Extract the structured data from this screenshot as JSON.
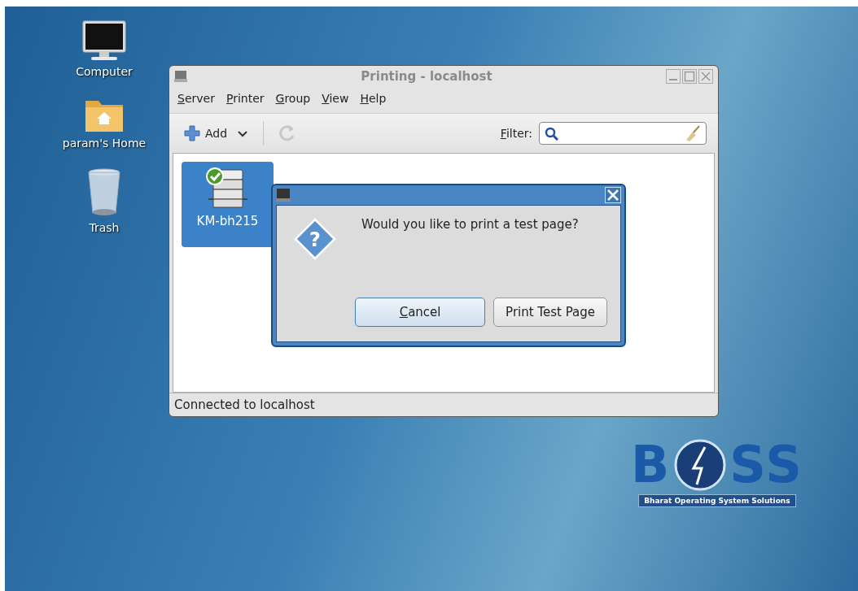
{
  "desktop_icons": [
    {
      "kind": "computer",
      "label": "Computer"
    },
    {
      "kind": "home",
      "label": "param's Home"
    },
    {
      "kind": "trash",
      "label": "Trash"
    }
  ],
  "window": {
    "title": "Printing - localhost",
    "active": false,
    "menu": [
      {
        "label": "Server",
        "underlined_first": true
      },
      {
        "label": "Printer",
        "underlined_first": true
      },
      {
        "label": "Group",
        "underlined_first": true
      },
      {
        "label": "View",
        "underlined_first": true
      },
      {
        "label": "Help",
        "underlined_first": true
      }
    ],
    "toolbar": {
      "add_label": "Add",
      "refresh_disabled": true,
      "filter_label": "Filter:",
      "filter_underlined_first": true
    },
    "printers": [
      {
        "name": "KM-bh215",
        "selected": true,
        "ready": true
      }
    ],
    "status_bar": "Connected to localhost"
  },
  "dialog": {
    "icon_glyph": "?",
    "message": "Would you like to print a test page?",
    "buttons": [
      {
        "label": "Cancel",
        "underlined_first": true,
        "hovered": true
      },
      {
        "label": "Print Test Page",
        "underlined_first": false,
        "hovered": false
      }
    ]
  },
  "logo": {
    "left": "B",
    "right": "SS",
    "tagline": "Bharat Operating System Solutions"
  }
}
